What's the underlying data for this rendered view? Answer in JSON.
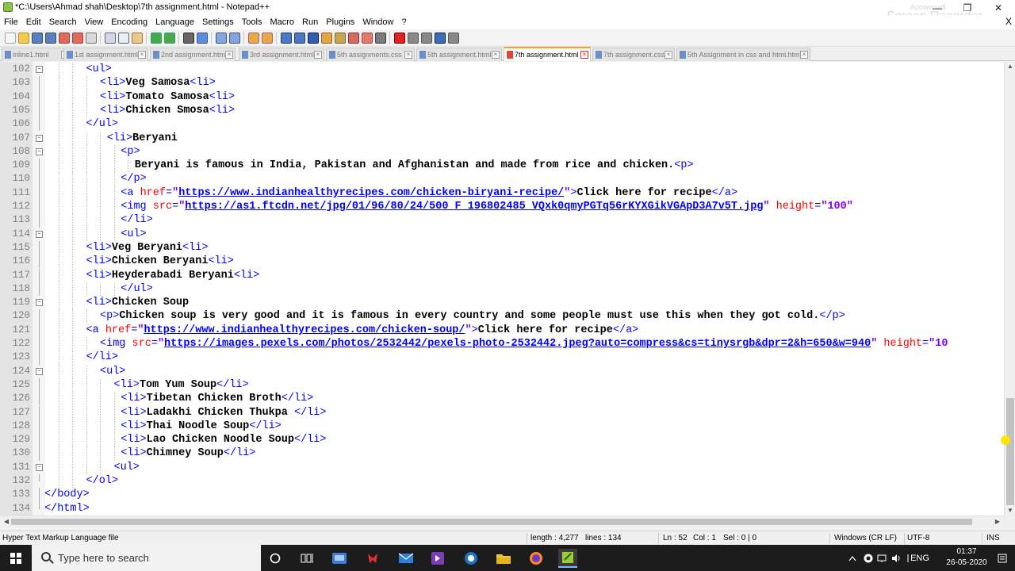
{
  "window": {
    "title": "*C:\\Users\\Ahmad shah\\Desktop\\7th assignment.html - Notepad++",
    "minimize": "—",
    "restore": "❐",
    "close": "✕",
    "watermark": "Screen Recorder",
    "watermark_small": "Apowersoft"
  },
  "menu": [
    "File",
    "Edit",
    "Search",
    "View",
    "Encoding",
    "Language",
    "Settings",
    "Tools",
    "Macro",
    "Run",
    "Plugins",
    "Window",
    "?"
  ],
  "menu_close": "X",
  "tabs": [
    {
      "label": "inline1.html",
      "active": false
    },
    {
      "label": "1st assignment.html",
      "active": false
    },
    {
      "label": "2nd assignment.html",
      "active": false
    },
    {
      "label": "3rd assignment.html",
      "active": false
    },
    {
      "label": "5th assignments.css",
      "active": false
    },
    {
      "label": "5th assignment.html",
      "active": false
    },
    {
      "label": "7th assignment.html",
      "active": true
    },
    {
      "label": "7th assignment.css",
      "active": false
    },
    {
      "label": "5th Assignment in css and html.html",
      "active": false
    }
  ],
  "editor_lines": [
    {
      "n": "102",
      "fold": "open",
      "indent": 6,
      "parts": [
        [
          "tag",
          "<ul>"
        ]
      ]
    },
    {
      "n": "103",
      "fold": "line",
      "indent": 8,
      "parts": [
        [
          "tag",
          "<li>"
        ],
        [
          "txt",
          "Veg Samosa"
        ],
        [
          "tag",
          "<li>"
        ]
      ]
    },
    {
      "n": "104",
      "fold": "line",
      "indent": 8,
      "parts": [
        [
          "tag",
          "<li>"
        ],
        [
          "txt",
          "Tomato Samosa"
        ],
        [
          "tag",
          "<li>"
        ]
      ]
    },
    {
      "n": "105",
      "fold": "line",
      "indent": 8,
      "parts": [
        [
          "tag",
          "<li>"
        ],
        [
          "txt",
          "Chicken Smosa"
        ],
        [
          "tag",
          "<li>"
        ]
      ]
    },
    {
      "n": "106",
      "fold": "line",
      "indent": 6,
      "parts": [
        [
          "tag",
          "</ul>"
        ]
      ]
    },
    {
      "n": "107",
      "fold": "open",
      "indent": 9,
      "parts": [
        [
          "tag",
          "<li>"
        ],
        [
          "txt",
          "Beryani"
        ]
      ]
    },
    {
      "n": "108",
      "fold": "open",
      "indent": 11,
      "parts": [
        [
          "tag",
          "<p>"
        ]
      ]
    },
    {
      "n": "109",
      "fold": "line",
      "indent": 13,
      "parts": [
        [
          "txt",
          "Beryani is famous in India, Pakistan and Afghanistan and made from rice and chicken."
        ],
        [
          "tag",
          "<p>"
        ]
      ]
    },
    {
      "n": "110",
      "fold": "line",
      "indent": 11,
      "parts": [
        [
          "tag",
          "</p>"
        ]
      ]
    },
    {
      "n": "111",
      "fold": "line",
      "indent": 11,
      "parts": [
        [
          "tag",
          "<a "
        ],
        [
          "attr",
          "href"
        ],
        [
          "tag",
          "="
        ],
        [
          "val",
          "\""
        ],
        [
          "url",
          "https://www.indianhealthyrecipes.com/chicken-biryani-recipe/"
        ],
        [
          "val",
          "\""
        ],
        [
          "tag",
          ">"
        ],
        [
          "txt",
          "Click here for recipe"
        ],
        [
          "tag",
          "</a>"
        ]
      ]
    },
    {
      "n": "112",
      "fold": "line",
      "indent": 11,
      "parts": [
        [
          "tag",
          "<img "
        ],
        [
          "attr",
          "src"
        ],
        [
          "tag",
          "="
        ],
        [
          "val",
          "\""
        ],
        [
          "url",
          "https://as1.ftcdn.net/jpg/01/96/80/24/500_F_196802485_VQxk0qmyPGTq56rKYXGikVGApD3A7v5T.jpg"
        ],
        [
          "val",
          "\""
        ],
        [
          "attr",
          " height"
        ],
        [
          "tag",
          "="
        ],
        [
          "val",
          "\"100\""
        ]
      ]
    },
    {
      "n": "113",
      "fold": "line",
      "indent": 11,
      "parts": [
        [
          "tag",
          "</li>"
        ]
      ]
    },
    {
      "n": "114",
      "fold": "open",
      "indent": 11,
      "parts": [
        [
          "tag",
          "<ul>"
        ]
      ]
    },
    {
      "n": "115",
      "fold": "line",
      "indent": 6,
      "parts": [
        [
          "tag",
          "<li>"
        ],
        [
          "txt",
          "Veg Beryani"
        ],
        [
          "tag",
          "<li>"
        ]
      ]
    },
    {
      "n": "116",
      "fold": "line",
      "indent": 6,
      "parts": [
        [
          "tag",
          "<li>"
        ],
        [
          "txt",
          "Chicken Beryani"
        ],
        [
          "tag",
          "<li>"
        ]
      ]
    },
    {
      "n": "117",
      "fold": "line",
      "indent": 6,
      "parts": [
        [
          "tag",
          "<li>"
        ],
        [
          "txt",
          "Heyderabadi Beryani"
        ],
        [
          "tag",
          "<li>"
        ]
      ]
    },
    {
      "n": "118",
      "fold": "line",
      "indent": 11,
      "parts": [
        [
          "tag",
          "</ul>"
        ]
      ]
    },
    {
      "n": "119",
      "fold": "open",
      "indent": 6,
      "parts": [
        [
          "tag",
          "<li>"
        ],
        [
          "txt",
          "Chicken Soup"
        ]
      ]
    },
    {
      "n": "120",
      "fold": "line",
      "indent": 8,
      "parts": [
        [
          "tag",
          "<p>"
        ],
        [
          "txt",
          "Chicken soup is very good and it is famous in every country and some people must use this when they got cold."
        ],
        [
          "tag",
          "</p>"
        ]
      ]
    },
    {
      "n": "121",
      "fold": "line",
      "indent": 6,
      "parts": [
        [
          "tag",
          "<a "
        ],
        [
          "attr",
          "href"
        ],
        [
          "tag",
          "="
        ],
        [
          "val",
          "\""
        ],
        [
          "url",
          "https://www.indianhealthyrecipes.com/chicken-soup/"
        ],
        [
          "val",
          "\""
        ],
        [
          "tag",
          ">"
        ],
        [
          "txt",
          "Click here for recipe"
        ],
        [
          "tag",
          "</a>"
        ]
      ]
    },
    {
      "n": "122",
      "fold": "line",
      "indent": 8,
      "parts": [
        [
          "tag",
          "<img "
        ],
        [
          "attr",
          "src"
        ],
        [
          "tag",
          "="
        ],
        [
          "val",
          "\""
        ],
        [
          "url",
          "https://images.pexels.com/photos/2532442/pexels-photo-2532442.jpeg?auto=compress&cs=tinysrgb&dpr=2&h=650&w=940"
        ],
        [
          "val",
          "\""
        ],
        [
          "attr",
          " height"
        ],
        [
          "tag",
          "="
        ],
        [
          "val",
          "\"10"
        ]
      ]
    },
    {
      "n": "123",
      "fold": "line",
      "indent": 6,
      "parts": [
        [
          "tag",
          "</li>"
        ]
      ]
    },
    {
      "n": "124",
      "fold": "open",
      "indent": 8,
      "parts": [
        [
          "tag",
          "<ul>"
        ]
      ]
    },
    {
      "n": "125",
      "fold": "line",
      "indent": 10,
      "parts": [
        [
          "tag",
          "<li>"
        ],
        [
          "txt",
          "Tom Yum Soup"
        ],
        [
          "tag",
          "</li>"
        ]
      ]
    },
    {
      "n": "126",
      "fold": "line",
      "indent": 11,
      "parts": [
        [
          "tag",
          "<li>"
        ],
        [
          "txt",
          "Tibetan Chicken Broth"
        ],
        [
          "tag",
          "</li>"
        ]
      ]
    },
    {
      "n": "127",
      "fold": "line",
      "indent": 11,
      "parts": [
        [
          "tag",
          "<li>"
        ],
        [
          "txt",
          "Ladakhi Chicken Thukpa "
        ],
        [
          "tag",
          "</li>"
        ]
      ]
    },
    {
      "n": "128",
      "fold": "line",
      "indent": 11,
      "parts": [
        [
          "tag",
          "<li>"
        ],
        [
          "txt",
          "Thai Noodle Soup"
        ],
        [
          "tag",
          "</li>"
        ]
      ]
    },
    {
      "n": "129",
      "fold": "line",
      "indent": 11,
      "parts": [
        [
          "tag",
          "<li>"
        ],
        [
          "txt",
          "Lao Chicken Noodle Soup"
        ],
        [
          "tag",
          "</li>"
        ]
      ]
    },
    {
      "n": "130",
      "fold": "line",
      "indent": 11,
      "parts": [
        [
          "tag",
          "<li>"
        ],
        [
          "txt",
          "Chimney Soup"
        ],
        [
          "tag",
          "</li>"
        ]
      ]
    },
    {
      "n": "131",
      "fold": "open",
      "indent": 10,
      "parts": [
        [
          "tag",
          "<ul>"
        ]
      ]
    },
    {
      "n": "132",
      "fold": "end",
      "indent": 6,
      "parts": [
        [
          "tag",
          "</ol>"
        ]
      ]
    },
    {
      "n": "133",
      "fold": "line",
      "indent": 0,
      "parts": [
        [
          "tag",
          "</body>"
        ]
      ]
    },
    {
      "n": "134",
      "fold": "end",
      "indent": 0,
      "parts": [
        [
          "tag",
          "</html>"
        ]
      ]
    }
  ],
  "statusbar": {
    "file_type": "Hyper Text Markup Language file",
    "length": "length : 4,277",
    "lines": "lines : 134",
    "ln": "Ln : 52",
    "col": "Col : 1",
    "sel": "Sel : 0 | 0",
    "eol": "Windows (CR LF)",
    "encoding": "UTF-8",
    "mode": "INS"
  },
  "taskbar": {
    "search_placeholder": "Type here to search",
    "time": "01:37",
    "date": "26-05-2020",
    "lang": "ENG"
  },
  "colors": {
    "tag": "#0000ff",
    "attribute": "#ff0000",
    "value": "#8000ff",
    "active_tab_accent": "#f8a028"
  }
}
